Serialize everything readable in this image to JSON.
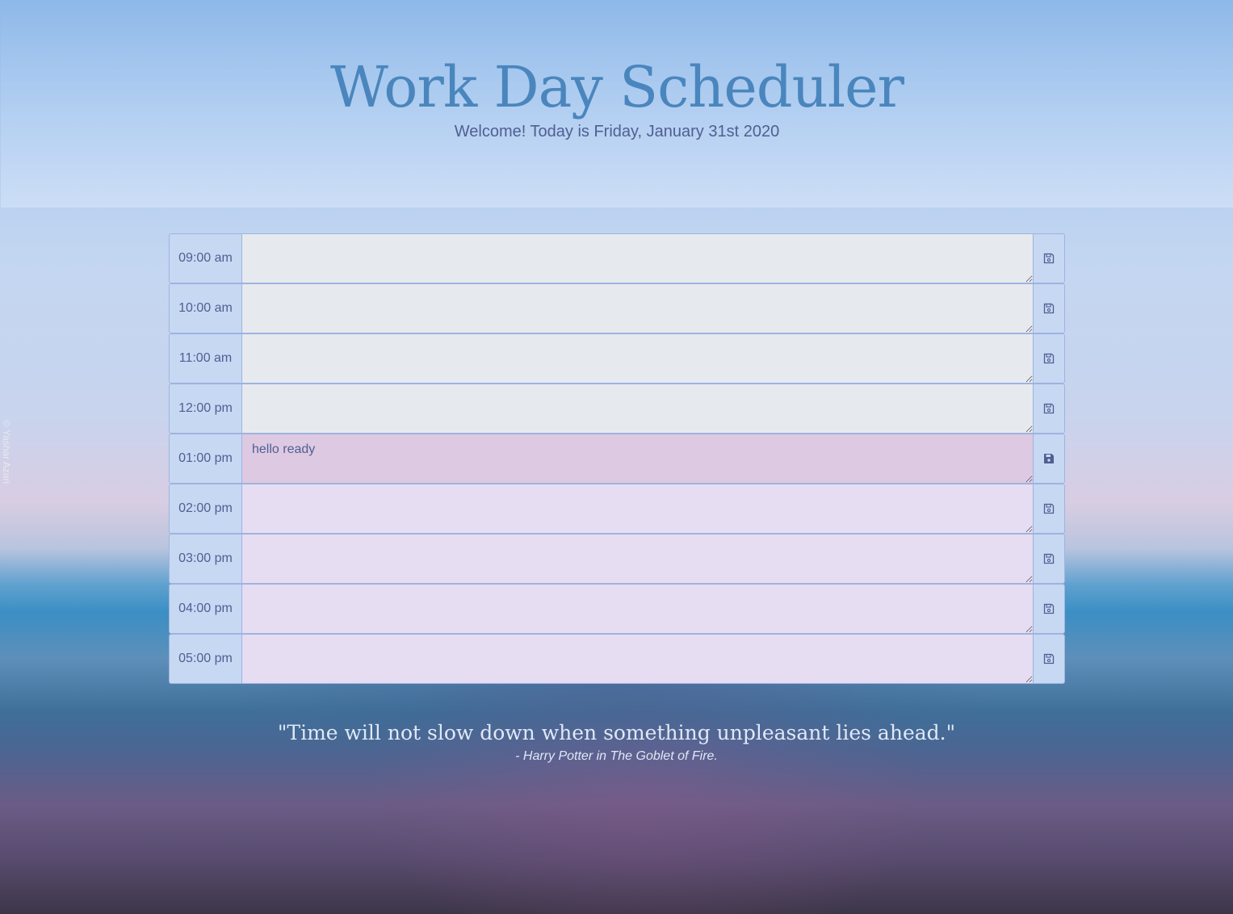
{
  "header": {
    "title": "Work Day Scheduler",
    "lead": "Welcome! Today is Friday, January 31st 2020"
  },
  "colors": {
    "past": "#e6eaef",
    "present": "#dec9e2",
    "future": "#e6ddf3",
    "title": "#4a86bd",
    "text": "#4f5f91"
  },
  "schedule": [
    {
      "hour": "09:00 am",
      "text": "",
      "state": "past",
      "save_icon": "floppy-disk-outline"
    },
    {
      "hour": "10:00 am",
      "text": "",
      "state": "past",
      "save_icon": "floppy-disk-outline"
    },
    {
      "hour": "11:00 am",
      "text": "",
      "state": "past",
      "save_icon": "floppy-disk-outline"
    },
    {
      "hour": "12:00 pm",
      "text": "",
      "state": "past",
      "save_icon": "floppy-disk-outline"
    },
    {
      "hour": "01:00 pm",
      "text": "hello ready",
      "state": "present",
      "save_icon": "floppy-disk-solid"
    },
    {
      "hour": "02:00 pm",
      "text": "",
      "state": "future",
      "save_icon": "floppy-disk-outline"
    },
    {
      "hour": "03:00 pm",
      "text": "",
      "state": "future",
      "save_icon": "floppy-disk-outline"
    },
    {
      "hour": "04:00 pm",
      "text": "",
      "state": "future",
      "save_icon": "floppy-disk-outline"
    },
    {
      "hour": "05:00 pm",
      "text": "",
      "state": "future",
      "save_icon": "floppy-disk-outline"
    }
  ],
  "quote": {
    "text": "\"Time will not slow down when something unpleasant lies ahead.\"",
    "cite": "- Harry Potter in The Goblet of Fire."
  },
  "credit": "© Yashar Azari"
}
